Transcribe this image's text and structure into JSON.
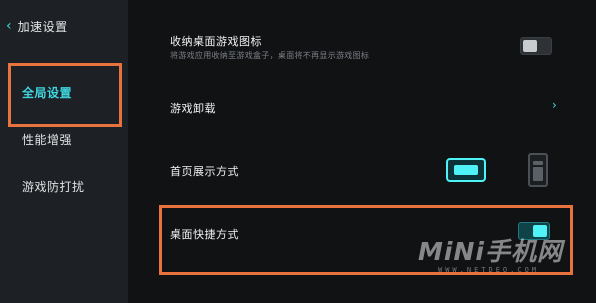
{
  "sidebar": {
    "back_label": "加速设置",
    "items": [
      {
        "label": "全局设置",
        "active": true
      },
      {
        "label": "性能增强",
        "active": false
      },
      {
        "label": "游戏防打扰",
        "active": false
      }
    ]
  },
  "settings": {
    "collapse_icons": {
      "title": "收纳桌面游戏图标",
      "subtitle": "将游戏应用收纳至游戏盒子，桌面将不再显示游戏图标",
      "toggle": "off"
    },
    "uninstall": {
      "title": "游戏卸载"
    },
    "home_display": {
      "title": "首页展示方式",
      "selected": "landscape",
      "options": [
        "landscape",
        "portrait"
      ]
    },
    "desktop_shortcut": {
      "title": "桌面快捷方式",
      "toggle": "on"
    }
  },
  "colors": {
    "accent": "#3fd6e0",
    "highlight_box": "#e8733f",
    "background": "#101214",
    "sidebar_bg": "#1d2024"
  },
  "watermark": {
    "brand": "MiNi手机网",
    "url": "WWW.NETDEO.COM"
  }
}
